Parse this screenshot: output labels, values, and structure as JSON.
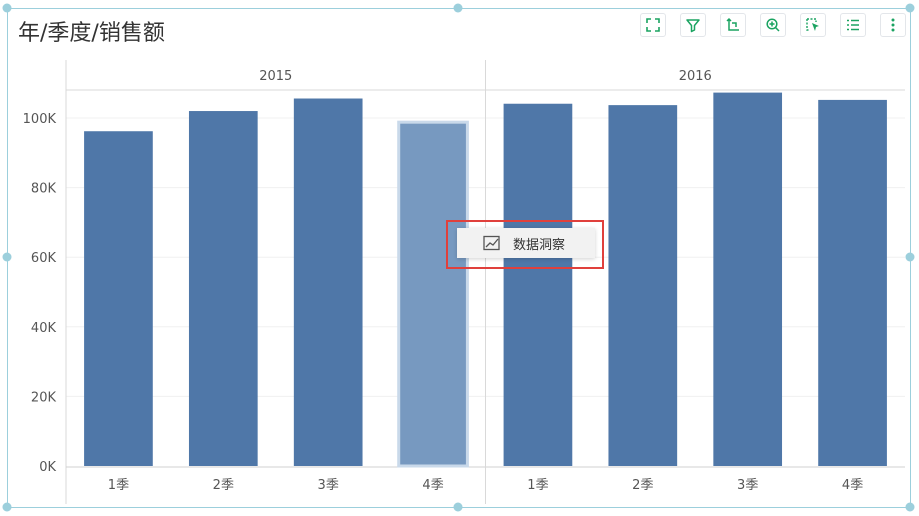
{
  "title": "年/季度/销售额",
  "toolbar": {
    "icons": [
      "fullscreen-icon",
      "filter-icon",
      "switch-icon",
      "zoom-in-icon",
      "select-icon",
      "list-icon",
      "more-icon"
    ],
    "accent": "#1aa361"
  },
  "context_menu": {
    "label": "数据洞察",
    "icon": "trend-chart-icon"
  },
  "colors": {
    "bar": "#4f77a8",
    "bar_selected": "#7799c0",
    "highlight_border": "#e0403c",
    "frame": "#9ccfdc"
  },
  "chart_data": {
    "type": "bar",
    "title": "年/季度/销售额",
    "groups": [
      {
        "label": "2015",
        "categories": [
          "1季",
          "2季",
          "3季",
          "4季"
        ],
        "values": [
          96200,
          102000,
          105600,
          98800
        ]
      },
      {
        "label": "2016",
        "categories": [
          "1季",
          "2季",
          "3季",
          "4季"
        ],
        "values": [
          104100,
          103700,
          107300,
          105200
        ]
      }
    ],
    "selected": {
      "group": 0,
      "index": 3
    },
    "y_ticks": [
      "0K",
      "20K",
      "40K",
      "60K",
      "80K",
      "100K"
    ],
    "y_tick_values": [
      0,
      20000,
      40000,
      60000,
      80000,
      100000
    ],
    "ylim": [
      0,
      108000
    ],
    "grid": true,
    "legend": "none"
  }
}
